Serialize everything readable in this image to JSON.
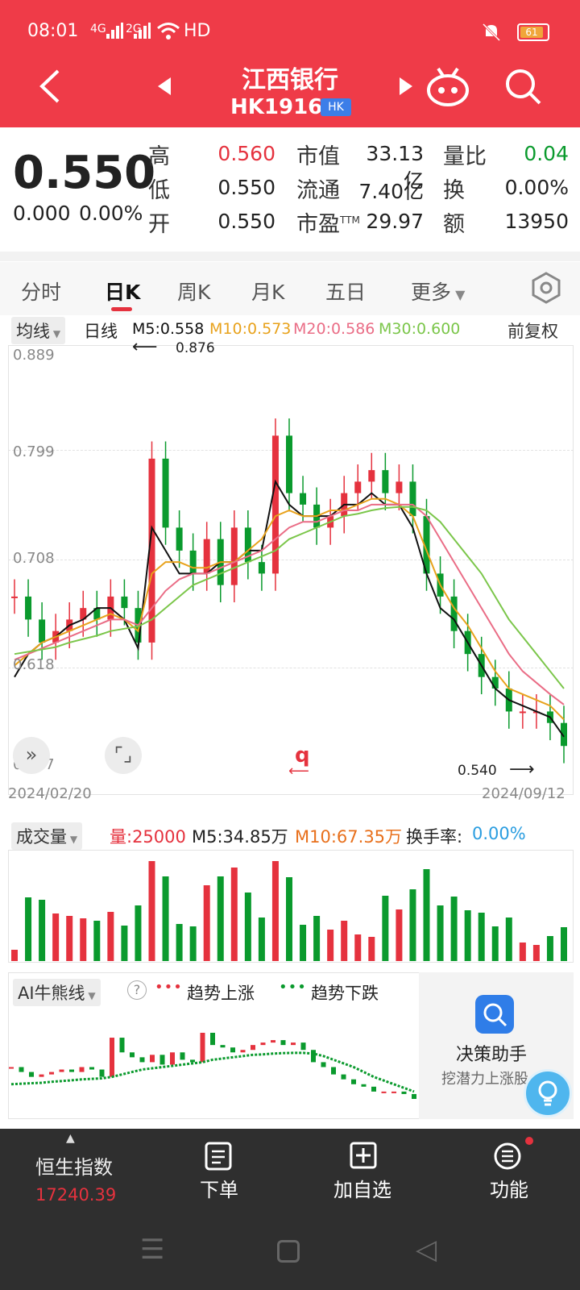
{
  "status_bar": {
    "time": "08:01",
    "signal_1": "4G",
    "signal_2": "2G",
    "network": "HD",
    "battery": "61"
  },
  "header": {
    "stock_name": "江西银行",
    "stock_code": "HK1916",
    "market_badge": "HK",
    "back_icon": "back-arrow-icon",
    "prev_icon": "triangle-left-icon",
    "next_icon": "triangle-right-icon",
    "robot_icon": "robot-icon",
    "search_icon": "search-icon"
  },
  "quote": {
    "price": "0.550",
    "change": "0.000",
    "change_pct": "0.00%",
    "high_label": "高",
    "high": "0.560",
    "low_label": "低",
    "low": "0.550",
    "open_label": "开",
    "open": "0.550",
    "mktcap_label": "市值",
    "mktcap": "33.13亿",
    "float_label": "流通",
    "float": "7.40亿",
    "pe_label": "市盈",
    "pe_sup": "TTM",
    "pe": "29.97",
    "vol_ratio_label": "量比",
    "vol_ratio": "0.04",
    "turnover_label": "换",
    "turnover": "0.00%",
    "amount_label": "额",
    "amount": "13950"
  },
  "tabs": [
    "分时",
    "日K",
    "周K",
    "月K",
    "五日",
    "更多"
  ],
  "active_tab": "日K",
  "ma_row": {
    "dropdown": "均线",
    "period": "日线",
    "m5": "M5:0.558",
    "m10": "M10:0.573",
    "m20": "M20:0.586",
    "m30": "M30:0.600",
    "adjust": "前复权"
  },
  "kchart": {
    "y_labels": [
      "0.889",
      "0.799",
      "0.708",
      "0.618",
      "0.527"
    ],
    "max_marker": "0.876",
    "min_marker": "0.540",
    "start_date": "2024/02/20",
    "end_date": "2024/09/12",
    "watermark": "q"
  },
  "volume": {
    "dropdown": "成交量",
    "vol": "量:25000",
    "m5": "M5:34.85万",
    "m10": "M10:67.35万",
    "turnover_label": "换手率:",
    "turnover_value": "0.00%"
  },
  "ai_panel": {
    "dropdown": "AI牛熊线",
    "help": "?",
    "up_legend": "趋势上涨",
    "down_legend": "趋势下跌",
    "assistant_title": "决策助手",
    "assistant_sub": "挖潜力上涨股"
  },
  "footer": {
    "index_name": "恒生指数",
    "index_value": "17240.39",
    "order": "下单",
    "add_watch": "加自选",
    "functions": "功能"
  },
  "colors": {
    "brand_red": "#ef3b48",
    "up_red": "#e5323e",
    "down_green": "#0a9a2d",
    "ma5": "#111111",
    "ma10": "#e8a21c",
    "ma20": "#ea6d86",
    "ma30": "#7bc64a"
  },
  "chart_data": {
    "type": "candlestick",
    "title": "江西银行 HK1916",
    "x_range": [
      "2024/02/20",
      "2024/09/12"
    ],
    "y_ticks": [
      0.889,
      0.799,
      0.708,
      0.618,
      0.527
    ],
    "ylim": [
      0.527,
      0.889
    ],
    "annotations": [
      {
        "label": "0.876",
        "kind": "max"
      },
      {
        "label": "0.540",
        "kind": "min"
      }
    ],
    "series": [
      {
        "name": "M5",
        "last": 0.558,
        "values": [
          0.61,
          0.63,
          0.64,
          0.645,
          0.655,
          0.66,
          0.67,
          0.67,
          0.66,
          0.635,
          0.74,
          0.72,
          0.7,
          0.7,
          0.7,
          0.71,
          0.71,
          0.72,
          0.72,
          0.78,
          0.76,
          0.75,
          0.75,
          0.75,
          0.76,
          0.76,
          0.77,
          0.76,
          0.76,
          0.74,
          0.7,
          0.67,
          0.66,
          0.64,
          0.62,
          0.6,
          0.59,
          0.585,
          0.58,
          0.575,
          0.558
        ]
      },
      {
        "name": "M10",
        "last": 0.573,
        "values": [
          0.62,
          0.63,
          0.64,
          0.645,
          0.65,
          0.655,
          0.66,
          0.665,
          0.66,
          0.65,
          0.7,
          0.71,
          0.71,
          0.705,
          0.705,
          0.71,
          0.71,
          0.72,
          0.73,
          0.75,
          0.755,
          0.75,
          0.75,
          0.755,
          0.755,
          0.76,
          0.765,
          0.765,
          0.76,
          0.75,
          0.72,
          0.69,
          0.67,
          0.655,
          0.635,
          0.615,
          0.6,
          0.595,
          0.59,
          0.585,
          0.573
        ]
      },
      {
        "name": "M20",
        "last": 0.586,
        "values": [
          0.625,
          0.63,
          0.635,
          0.64,
          0.645,
          0.65,
          0.655,
          0.66,
          0.66,
          0.655,
          0.67,
          0.685,
          0.695,
          0.7,
          0.7,
          0.705,
          0.71,
          0.715,
          0.72,
          0.73,
          0.74,
          0.745,
          0.745,
          0.75,
          0.755,
          0.755,
          0.76,
          0.76,
          0.76,
          0.76,
          0.75,
          0.73,
          0.71,
          0.69,
          0.67,
          0.65,
          0.63,
          0.615,
          0.605,
          0.595,
          0.586
        ]
      },
      {
        "name": "M30",
        "last": 0.6,
        "values": [
          0.63,
          0.632,
          0.634,
          0.636,
          0.64,
          0.643,
          0.646,
          0.65,
          0.652,
          0.654,
          0.66,
          0.67,
          0.68,
          0.69,
          0.695,
          0.7,
          0.705,
          0.71,
          0.715,
          0.72,
          0.73,
          0.735,
          0.74,
          0.745,
          0.75,
          0.752,
          0.755,
          0.757,
          0.758,
          0.758,
          0.755,
          0.745,
          0.73,
          0.715,
          0.7,
          0.68,
          0.66,
          0.645,
          0.63,
          0.615,
          0.6
        ]
      }
    ],
    "candles_close": [
      0.68,
      0.66,
      0.64,
      0.65,
      0.66,
      0.67,
      0.66,
      0.68,
      0.67,
      0.64,
      0.8,
      0.74,
      0.72,
      0.7,
      0.73,
      0.69,
      0.74,
      0.71,
      0.7,
      0.82,
      0.77,
      0.76,
      0.74,
      0.75,
      0.77,
      0.78,
      0.79,
      0.77,
      0.78,
      0.75,
      0.7,
      0.68,
      0.65,
      0.63,
      0.61,
      0.6,
      0.58,
      0.58,
      0.58,
      0.57,
      0.55
    ]
  }
}
